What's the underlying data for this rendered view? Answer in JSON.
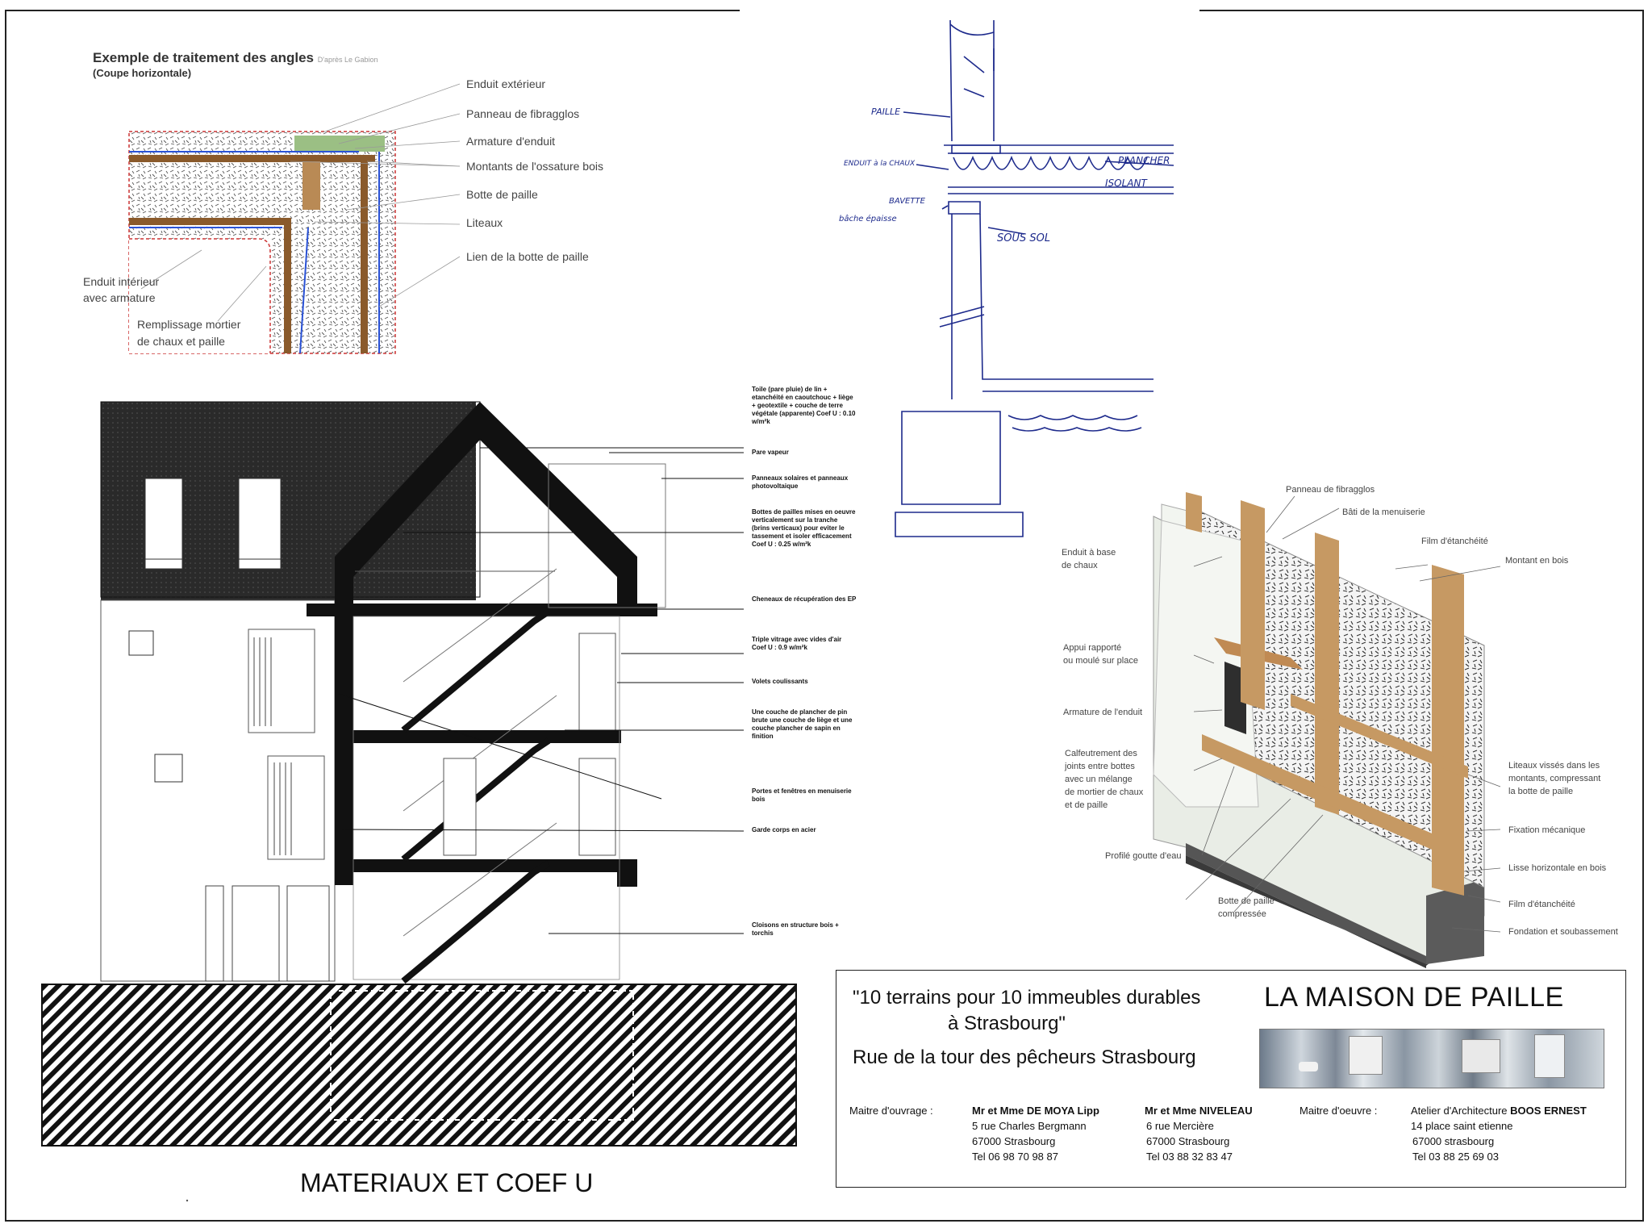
{
  "corner_detail": {
    "title": "Exemple de traitement des angles",
    "title_note": "D'après Le Gabion",
    "subtitle": "(Coupe horizontale)",
    "labels": [
      "Enduit extérieur",
      "Panneau de fibragglos",
      "Armature d'enduit",
      "Montants de l'ossature bois",
      "Botte de paille",
      "Liteaux",
      "Lien de la botte de paille"
    ],
    "left_label_1": "Enduit intérieur",
    "left_label_2": "avec armature",
    "left_label_3": "Remplissage mortier",
    "left_label_4": "de chaux et paille"
  },
  "sketch": {
    "paille": "PAILLE",
    "enduit": "ENDUIT à la CHAUX",
    "bavette": "BAVETTE",
    "bache": "bâche épaisse",
    "plancher": "PLANCHER",
    "isolant": "ISOLANT",
    "sous_sol": "SOUS SOL"
  },
  "section_notes": [
    "Toile (pare pluie) de lin + etanchéité en caoutchouc + liège + geotextile + couche de terre végétale (apparente) Coef U : 0.10 w/m²k",
    "Pare vapeur",
    "Panneaux solaires et panneaux photovoltaique",
    "Bottes de pailles mises en oeuvre verticalement sur la tranche (brins verticaux) pour eviter le tassement et isoler efficacement Coef U : 0.25 w/m²k",
    "Cheneaux de récupération des EP",
    "Triple vitrage avec vides d'air Coef U : 0.9 w/m²k",
    "Volets coulissants",
    "Une couche de plancher de pin brute une couche de liège et une couche plancher de sapin en finition",
    "Portes et fenêtres en menuiserie bois",
    "Garde corps en acier",
    "Cloisons en structure bois + torchis"
  ],
  "iso_detail": {
    "panneau": "Panneau de fibragglos",
    "bati": "Bâti de la menuiserie",
    "enduit_1": "Enduit à base",
    "enduit_2": "de chaux",
    "film_top": "Film d'étanchéité",
    "montant": "Montant en bois",
    "appui_1": "Appui rapporté",
    "appui_2": "ou moulé sur place",
    "armature": "Armature de l'enduit",
    "calf_1": "Calfeutrement des",
    "calf_2": "joints entre bottes",
    "calf_3": "avec un mélange",
    "calf_4": "de mortier de chaux",
    "calf_5": "et de paille",
    "liteaux_1": "Liteaux vissés dans les",
    "liteaux_2": "montants, compressant",
    "liteaux_3": "la botte de paille",
    "fixation": "Fixation mécanique",
    "profile": "Profilé goutte d'eau",
    "lisse": "Lisse horizontale en bois",
    "botte_1": "Botte de paille",
    "botte_2": "compressée",
    "film_bottom": "Film d'étanchéité",
    "fondation": "Fondation et soubassement"
  },
  "title_block": {
    "line1": "\"10 terrains pour 10 immeubles durables",
    "line2": "à Strasbourg\"",
    "line3": "Rue de la tour des pêcheurs Strasbourg",
    "brand": "LA MAISON DE PAILLE",
    "maitre_ouvrage_label": "Maitre d'ouvrage  :",
    "client1_name": "Mr et Mme DE MOYA Lipp",
    "client1_addr1": "5 rue Charles Bergmann",
    "client1_addr2": "67000 Strasbourg",
    "client1_tel": "Tel 06 98 70 98 87",
    "client2_name": "Mr et Mme NIVELEAU",
    "client2_addr1": "6 rue Mercière",
    "client2_addr2": "67000 Strasbourg",
    "client2_tel": "Tel 03 88 32 83 47",
    "maitre_oeuvre_label": "Maitre d'oeuvre  :",
    "architect_prefix": "Atelier d'Architecture",
    "architect_name": "BOOS ERNEST",
    "architect_addr1": "14 place saint etienne",
    "architect_addr2": "67000 strasbourg",
    "architect_tel": "Tel 03 88 25 69 03"
  },
  "footer_title": "MATERIAUX ET COEF U"
}
